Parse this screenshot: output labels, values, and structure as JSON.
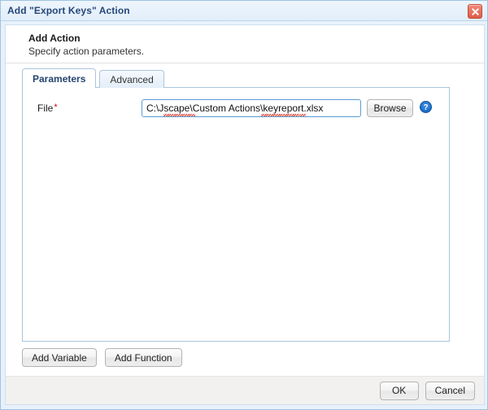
{
  "window": {
    "title": "Add \"Export Keys\" Action",
    "close_icon": "close-icon",
    "accent_color": "#24487a",
    "close_color": "#dd5c49"
  },
  "header": {
    "title": "Add Action",
    "subtitle": "Specify action parameters."
  },
  "tabs": [
    {
      "label": "Parameters",
      "active": true
    },
    {
      "label": "Advanced",
      "active": false
    }
  ],
  "form": {
    "file": {
      "label": "File",
      "required_marker": "*",
      "value": "C:\\Jscape\\Custom Actions\\keyreport.xlsx",
      "placeholder": "",
      "browse_label": "Browse",
      "help_icon": "help-circle-icon"
    }
  },
  "lower_buttons": [
    {
      "label": "Add Variable"
    },
    {
      "label": "Add Function"
    }
  ],
  "footer_buttons": [
    {
      "label": "OK"
    },
    {
      "label": "Cancel"
    }
  ]
}
